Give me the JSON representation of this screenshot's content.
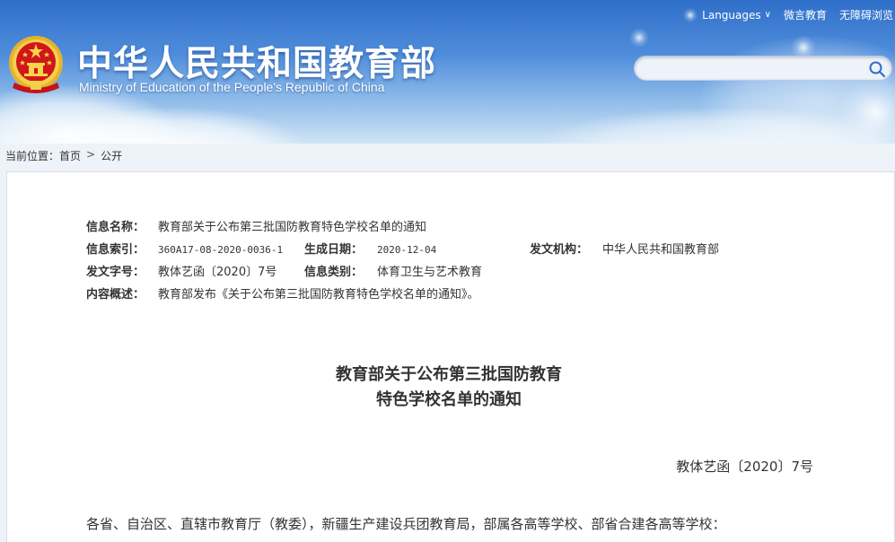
{
  "header": {
    "title_cn": "中华人民共和国教育部",
    "title_en": "Ministry of Education of the People's Republic of China",
    "top_links": {
      "languages": "Languages",
      "weiyan": "微言教育",
      "accessibility": "无障碍浏览"
    },
    "search": {
      "value": "",
      "placeholder": ""
    }
  },
  "breadcrumb": {
    "label": "当前位置：",
    "home": "首页",
    "separator": ">",
    "current": "公开"
  },
  "meta": {
    "name_label": "信息名称：",
    "name_value": "教育部关于公布第三批国防教育特色学校名单的通知",
    "index_label": "信息索引：",
    "index_value": "360A17-08-2020-0036-1",
    "date_label": "生成日期：",
    "date_value": "2020-12-04",
    "issuer_label": "发文机构：",
    "issuer_value": "中华人民共和国教育部",
    "docno_label": "发文字号：",
    "docno_value": "教体艺函〔2020〕7号",
    "category_label": "信息类别：",
    "category_value": "体育卫生与艺术教育",
    "summary_label": "内容概述：",
    "summary_value": "教育部发布《关于公布第三批国防教育特色学校名单的通知》。"
  },
  "document": {
    "title_line1": "教育部关于公布第三批国防教育",
    "title_line2": "特色学校名单的通知",
    "number": "教体艺函〔2020〕7号",
    "salutation": "各省、自治区、直辖市教育厅（教委），新疆生产建设兵团教育局，部属各高等学校、部省合建各高等学校："
  },
  "colors": {
    "header_blue": "#2f6fc9",
    "emblem_red": "#d0171b",
    "emblem_gold": "#f2c230"
  }
}
